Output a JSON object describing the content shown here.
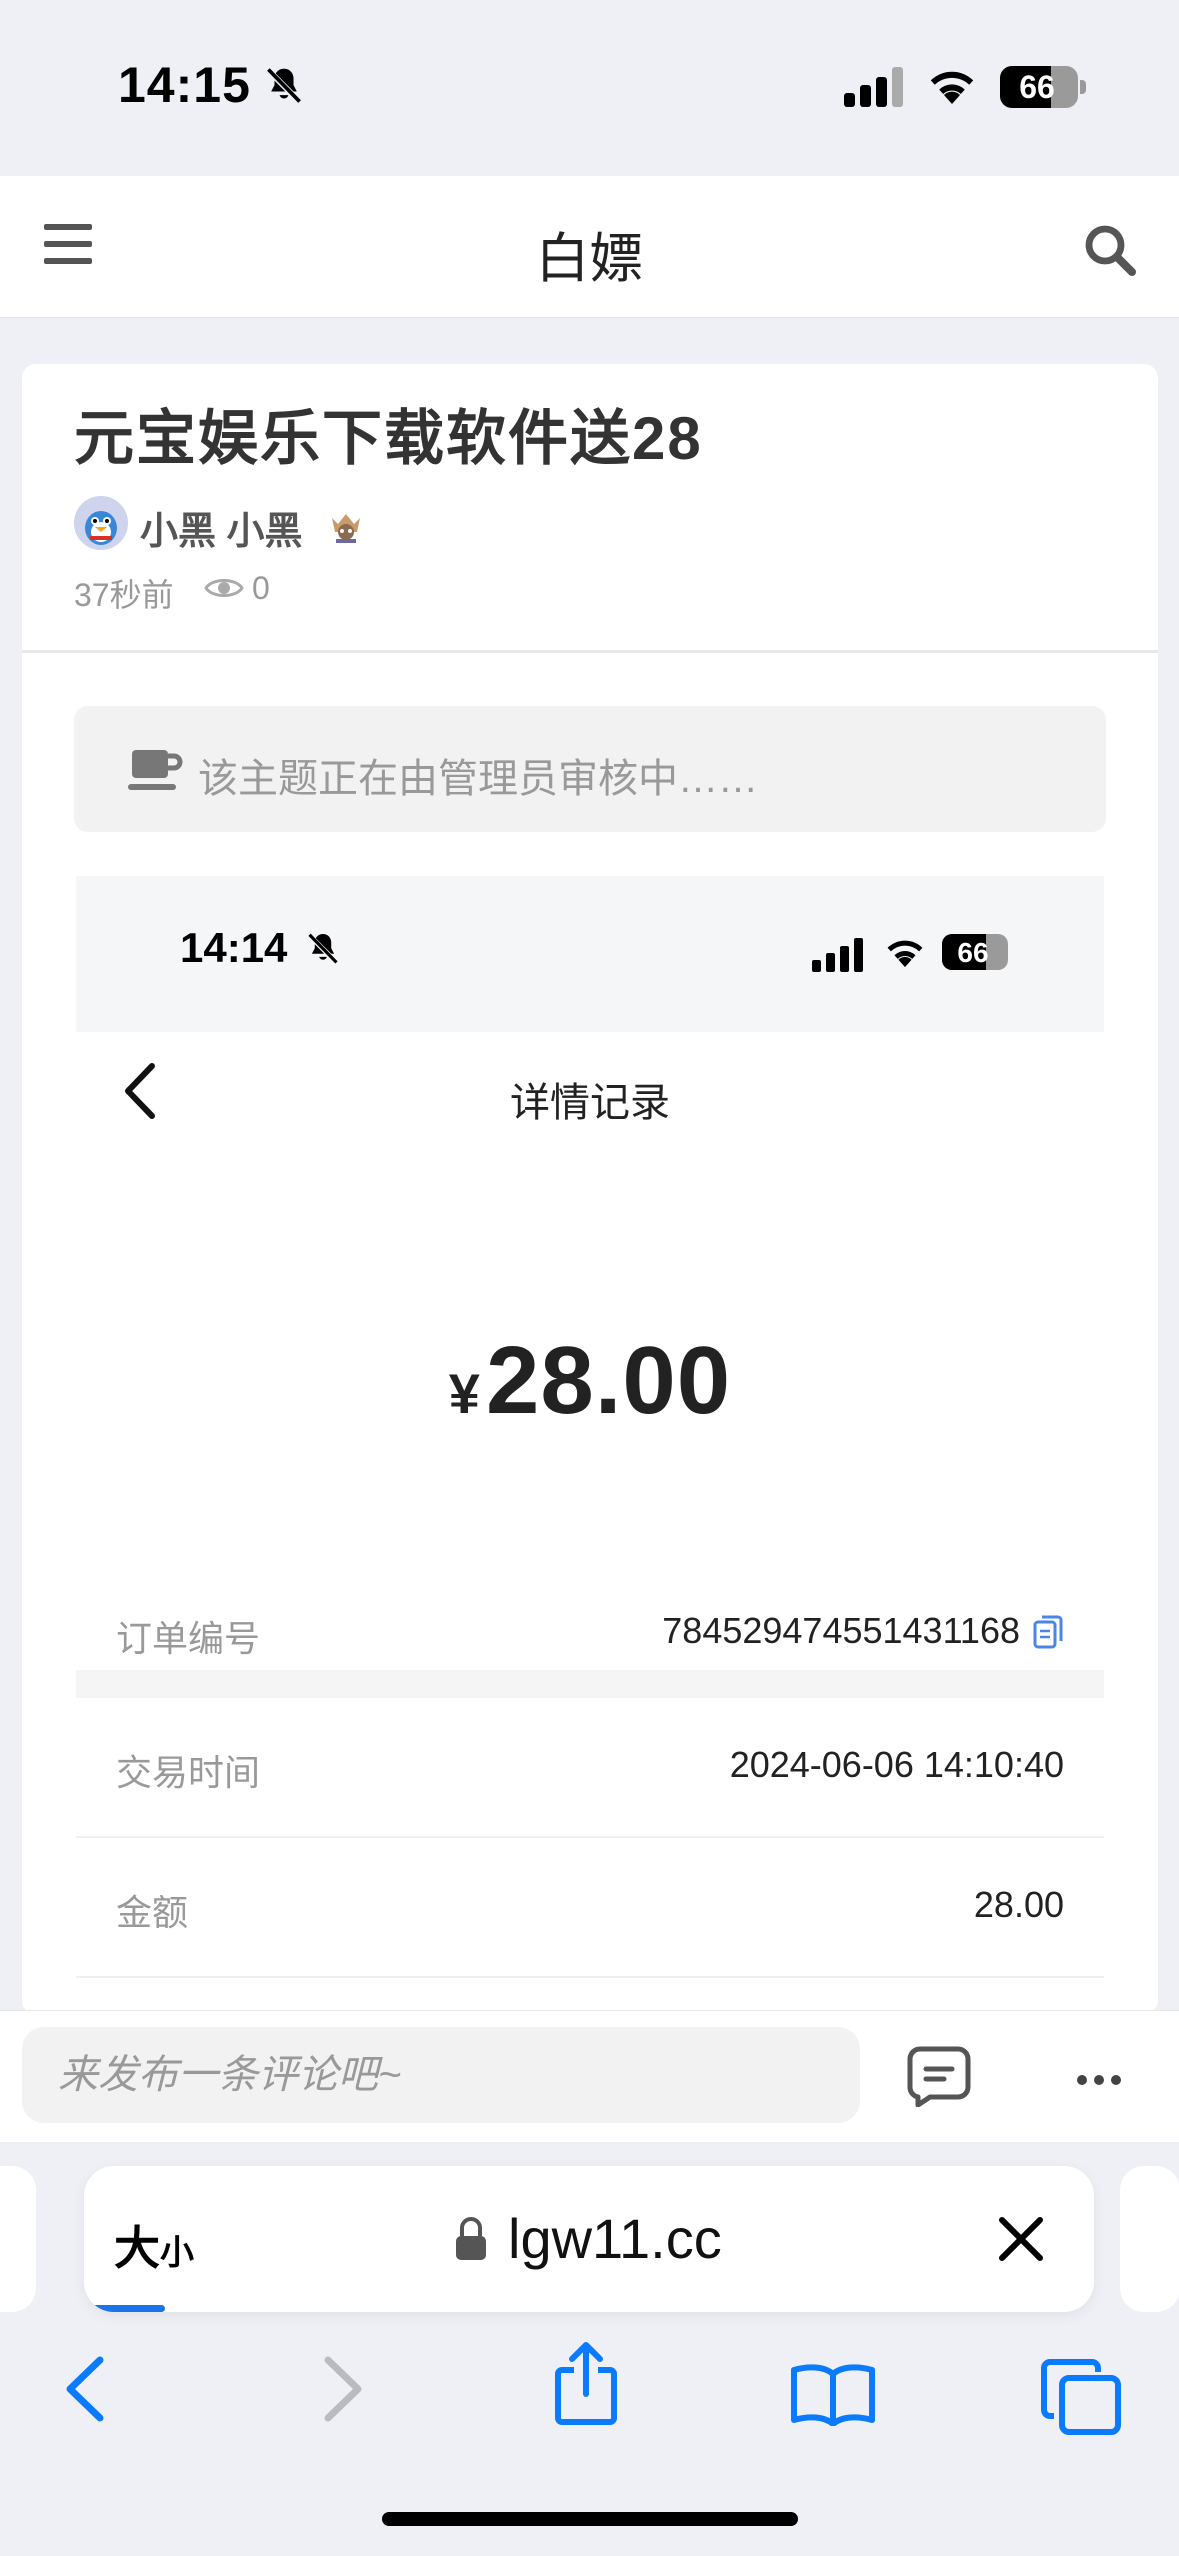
{
  "status_bar": {
    "time": "14:15",
    "battery": "66"
  },
  "header": {
    "title": "白嫖"
  },
  "post": {
    "title": "元宝娱乐下载软件送28",
    "author": "小黑 小黑",
    "time_ago": "37秒前",
    "views": "0",
    "notice": "该主题正在由管理员审核中……"
  },
  "embedded": {
    "time": "14:14",
    "battery": "66",
    "title": "详情记录",
    "currency": "¥",
    "amount": "28.00",
    "rows": [
      {
        "label": "订单编号",
        "value": "784529474551431168"
      },
      {
        "label": "交易时间",
        "value": "2024-06-06 14:10:40"
      },
      {
        "label": "金额",
        "value": "28.00"
      }
    ]
  },
  "comment": {
    "placeholder": "来发布一条评论吧~"
  },
  "safari": {
    "text_size_big": "大",
    "text_size_small": "小",
    "url": "lgw11.cc",
    "load_progress": 0.08
  },
  "colors": {
    "accent": "#1a73e8",
    "ios_blue": "#0a7aff"
  }
}
